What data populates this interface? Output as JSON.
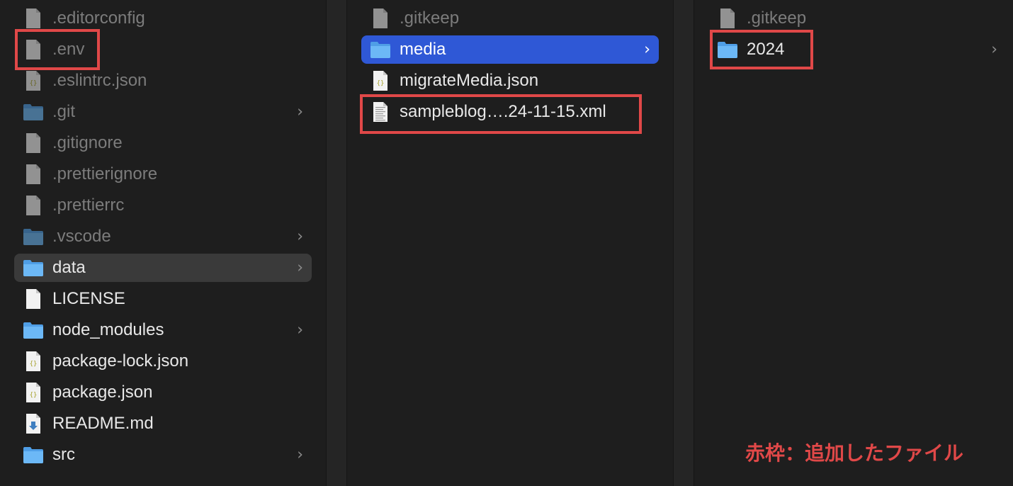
{
  "columns": [
    {
      "items": [
        {
          "label": ".editorconfig",
          "type": "file",
          "dim": true
        },
        {
          "label": ".env",
          "type": "file",
          "dim": true,
          "highlight": true
        },
        {
          "label": ".eslintrc.json",
          "type": "json",
          "dim": true
        },
        {
          "label": ".git",
          "type": "folder",
          "dim": true,
          "chevron": true
        },
        {
          "label": ".gitignore",
          "type": "file",
          "dim": true
        },
        {
          "label": ".prettierignore",
          "type": "file",
          "dim": true
        },
        {
          "label": ".prettierrc",
          "type": "file",
          "dim": true
        },
        {
          "label": ".vscode",
          "type": "folder",
          "dim": true,
          "chevron": true
        },
        {
          "label": "data",
          "type": "folder",
          "chevron": true,
          "selected": "inactive"
        },
        {
          "label": "LICENSE",
          "type": "file"
        },
        {
          "label": "node_modules",
          "type": "folder",
          "chevron": true
        },
        {
          "label": "package-lock.json",
          "type": "json"
        },
        {
          "label": "package.json",
          "type": "json"
        },
        {
          "label": "README.md",
          "type": "markdown"
        },
        {
          "label": "src",
          "type": "folder",
          "chevron": true
        }
      ]
    },
    {
      "items": [
        {
          "label": ".gitkeep",
          "type": "file",
          "dim": true
        },
        {
          "label": "media",
          "type": "folder",
          "chevron": true,
          "selected": "active"
        },
        {
          "label": "migrateMedia.json",
          "type": "json"
        },
        {
          "label": "sampleblog….24-11-15.xml",
          "type": "xml",
          "highlight": true
        }
      ]
    },
    {
      "items": [
        {
          "label": ".gitkeep",
          "type": "file",
          "dim": true
        },
        {
          "label": "2024",
          "type": "folder",
          "chevron": true,
          "highlight": true
        }
      ]
    }
  ],
  "chevron_glyph": "›",
  "note": "赤枠：追加したファイル",
  "colors": {
    "background": "#1e1e1e",
    "selected_active": "#2f58d6",
    "selected_inactive": "#3a3a3a",
    "highlight": "#e04848",
    "folder": "#5aaaf0"
  }
}
